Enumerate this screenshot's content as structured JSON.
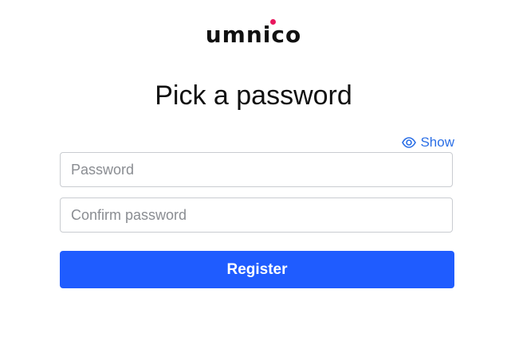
{
  "brand": {
    "logo_text": "umnico",
    "dot_color": "#e8175d"
  },
  "page": {
    "title": "Pick a password"
  },
  "form": {
    "show_toggle": {
      "label": "Show",
      "icon": "eye-icon"
    },
    "password": {
      "value": "",
      "placeholder": "Password"
    },
    "confirm_password": {
      "value": "",
      "placeholder": "Confirm password"
    },
    "submit_label": "Register"
  },
  "colors": {
    "accent": "#1f5cff",
    "link": "#2b6fe6",
    "border": "#c9ccd1"
  }
}
